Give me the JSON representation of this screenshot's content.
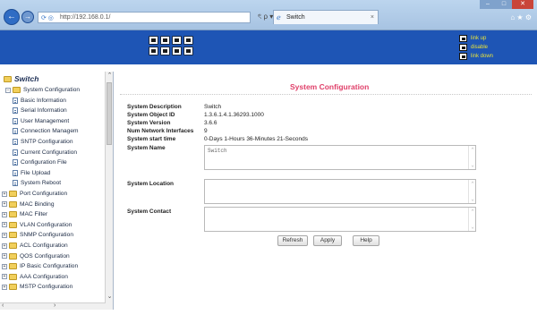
{
  "browser": {
    "address": "http://192.168.0.1/",
    "tab_title": "Switch",
    "tab_close": "×",
    "addr_tools": "ৎ ρ ▾",
    "back": "←",
    "forward": "→",
    "icons": "⌂ ★ ⚙"
  },
  "legend": [
    {
      "label": "link up"
    },
    {
      "label": "disable"
    },
    {
      "label": "link down"
    }
  ],
  "sidebar": {
    "root": "Switch",
    "items": [
      {
        "label": "System Configuration",
        "kind": "folder",
        "open": true
      },
      {
        "label": "Basic Information",
        "kind": "doc"
      },
      {
        "label": "Serial Information",
        "kind": "doc"
      },
      {
        "label": "User Management",
        "kind": "doc"
      },
      {
        "label": "Connection Managem",
        "kind": "doc"
      },
      {
        "label": "SNTP Configuration",
        "kind": "doc"
      },
      {
        "label": "Current Configuration",
        "kind": "doc"
      },
      {
        "label": "Configuration File",
        "kind": "doc"
      },
      {
        "label": "File Upload",
        "kind": "doc"
      },
      {
        "label": "System Reboot",
        "kind": "doc"
      },
      {
        "label": "Port Configuration",
        "kind": "folder"
      },
      {
        "label": "MAC Binding",
        "kind": "folder"
      },
      {
        "label": "MAC Filter",
        "kind": "folder"
      },
      {
        "label": "VLAN Configuration",
        "kind": "folder"
      },
      {
        "label": "SNMP Configuration",
        "kind": "folder"
      },
      {
        "label": "ACL Configuration",
        "kind": "folder"
      },
      {
        "label": "QOS Configuration",
        "kind": "folder"
      },
      {
        "label": "IP Basic Configuration",
        "kind": "folder"
      },
      {
        "label": "AAA Configuration",
        "kind": "folder"
      },
      {
        "label": "MSTP Configuration",
        "kind": "folder"
      }
    ]
  },
  "main": {
    "title": "System Configuration",
    "info": [
      {
        "label": "System Description",
        "value": "Switch"
      },
      {
        "label": "System Object ID",
        "value": "1.3.6.1.4.1.36293.1000"
      },
      {
        "label": "System Version",
        "value": "3.6.6"
      },
      {
        "label": "Num Network Interfaces",
        "value": "9"
      },
      {
        "label": "System start time",
        "value": "0-Days 1-Hours 36-Minutes 21-Seconds"
      }
    ],
    "fields": [
      {
        "label": "System Name",
        "value": "Switch"
      },
      {
        "label": "System Location",
        "value": ""
      },
      {
        "label": "System Contact",
        "value": ""
      }
    ],
    "buttons": {
      "refresh": "Refresh",
      "apply": "Apply",
      "help": "Help"
    }
  }
}
